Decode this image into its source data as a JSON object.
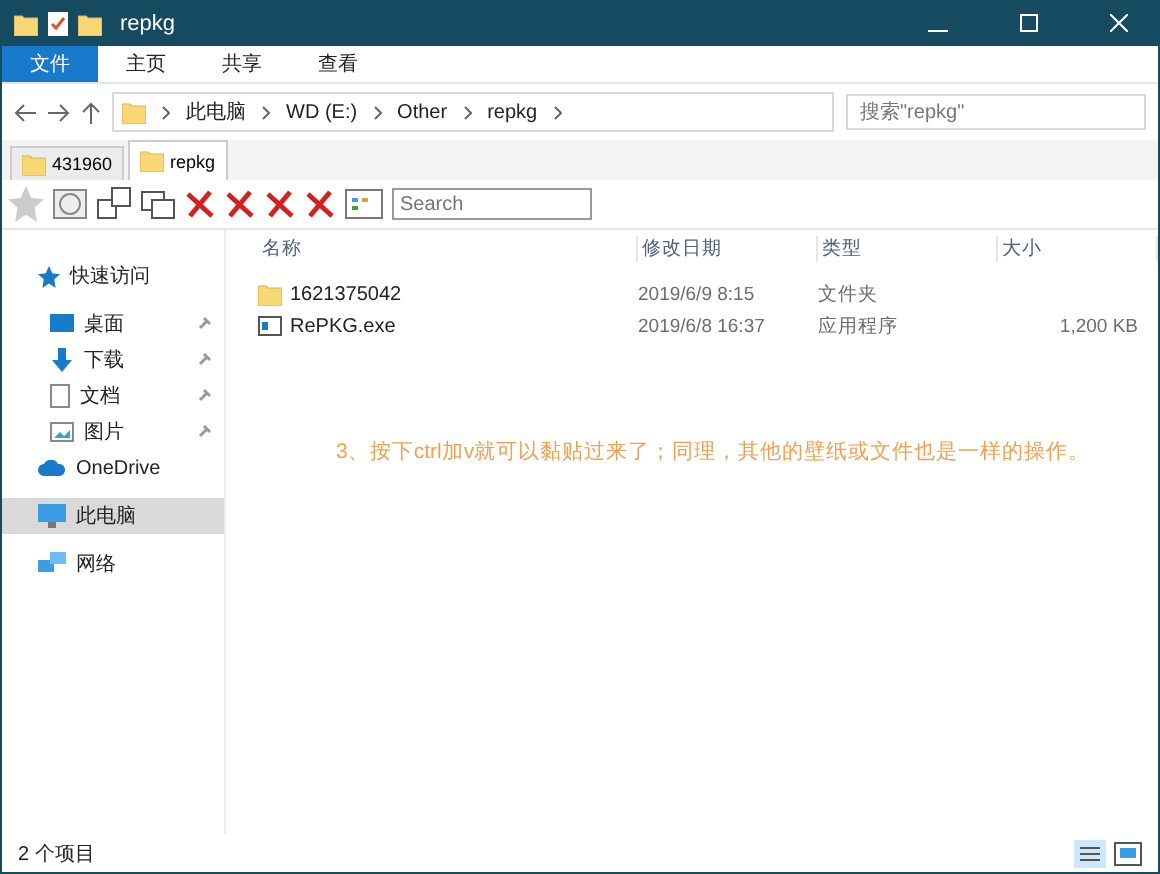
{
  "window": {
    "title": "repkg"
  },
  "ribbon_tabs": [
    {
      "label": "文件",
      "selected": true
    },
    {
      "label": "主页",
      "selected": false
    },
    {
      "label": "共享",
      "selected": false
    },
    {
      "label": "查看",
      "selected": false
    }
  ],
  "breadcrumb": [
    "此电脑",
    "WD (E:)",
    "Other",
    "repkg"
  ],
  "search": {
    "placeholder": "搜索\"repkg\""
  },
  "folder_tabs": [
    {
      "label": "431960",
      "selected": false
    },
    {
      "label": "repkg",
      "selected": true
    }
  ],
  "toolbar_search": {
    "placeholder": "Search"
  },
  "sidebar": [
    {
      "label": "快速访问",
      "kind": "group",
      "selected": false,
      "children": [
        {
          "label": "桌面",
          "pinned": true,
          "selected": false
        },
        {
          "label": "下载",
          "pinned": true,
          "selected": false
        },
        {
          "label": "文档",
          "pinned": true,
          "selected": false
        },
        {
          "label": "图片",
          "pinned": true,
          "selected": false
        }
      ]
    },
    {
      "label": "OneDrive",
      "kind": "cloud",
      "selected": false
    },
    {
      "label": "此电脑",
      "kind": "pc",
      "selected": true
    },
    {
      "label": "网络",
      "kind": "network",
      "selected": false
    }
  ],
  "table": {
    "columns": [
      "名称",
      "修改日期",
      "类型",
      "大小"
    ],
    "rows": [
      {
        "kind": "folder",
        "cells": [
          "1621375042",
          "2019/6/9 8:15",
          "文件夹",
          ""
        ]
      },
      {
        "kind": "exe",
        "cells": [
          "RePKG.exe",
          "2019/6/8 16:37",
          "应用程序",
          "1,200 KB"
        ]
      }
    ]
  },
  "annotation": "3、按下ctrl加v就可以黏贴过来了；同理，其他的壁纸或文件也是一样的操作。",
  "status_bar": "2 个项目"
}
